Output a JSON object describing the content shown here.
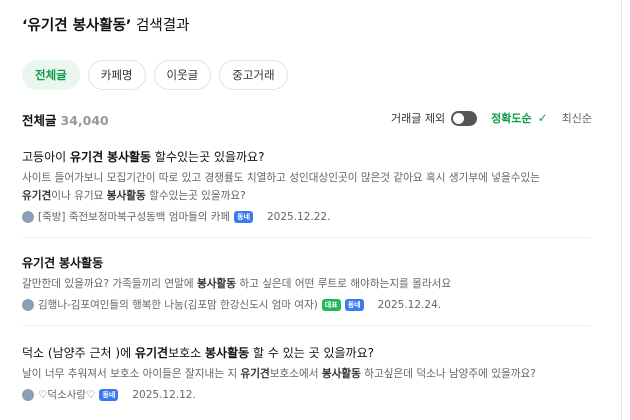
{
  "header": {
    "query_quoted": "‘유기견 봉사활동’",
    "suffix": " 검색결과"
  },
  "tabs": [
    {
      "label": "전체글",
      "active": true
    },
    {
      "label": "카페명",
      "active": false
    },
    {
      "label": "이웃글",
      "active": false
    },
    {
      "label": "중고거래",
      "active": false
    }
  ],
  "summary": {
    "label": "전체글",
    "count": "34,040",
    "exclude_trade": "거래글 제외",
    "sort_accuracy": "정확도순",
    "sort_latest": "최신순"
  },
  "results": [
    {
      "title_pre": "고등아이 ",
      "title_hl1": "유기견",
      "title_mid": " ",
      "title_hl2": "봉사활동",
      "title_post": " 할수있는곳 있을까요?",
      "desc_line1": "사이트 들어가보니 모집기간이 따로 있고 경쟁률도 치열하고 성인대상인곳이 많은것 같아요 혹시 생기부에 넣을수있는",
      "desc_hl1": "유기견",
      "desc_l2a": "이나 유기묘 ",
      "desc_hl2": "봉사활동",
      "desc_l2b": " 할수있는곳 있을까요?",
      "cafe": "[죽방] 죽전보정마북구성동백 엄마들의 카페",
      "badges": [
        "동네"
      ],
      "date": "2025.12.22."
    },
    {
      "title_pre": "",
      "title_hl1": "유기견",
      "title_mid": " ",
      "title_hl2": "봉사활동",
      "title_post": "",
      "desc_a": "갈만한데 있을까요? 가족들끼리 연말에 ",
      "desc_hl": "봉사활동",
      "desc_b": " 하고 싶은데 어떤 루트로 해야하는지를 몰라서요",
      "cafe": "김행나-김포여인들의 행복한 나눔(김포맘 한강신도시 엄마 여자)",
      "badges": [
        "대표",
        "동네"
      ],
      "date": "2025.12.24."
    },
    {
      "title_pre": "덕소 (남양주 근처 )에 ",
      "title_hl1": "유기견",
      "title_mid": "보호소 ",
      "title_hl2": "봉사활동",
      "title_post": " 할 수 있는 곳 있을까요?",
      "desc_a": "날이 너무 추워져서 보호소 아이들은 잘지내는 지 ",
      "desc_hl1": "유기견",
      "desc_b": "보호소에서 ",
      "desc_hl2": "봉사활동",
      "desc_c": " 하고싶은데 덕소나 남양주에 있을까요?",
      "cafe": "♡덕소사랑♡",
      "badges": [
        "동네"
      ],
      "date": "2025.12.12."
    }
  ]
}
